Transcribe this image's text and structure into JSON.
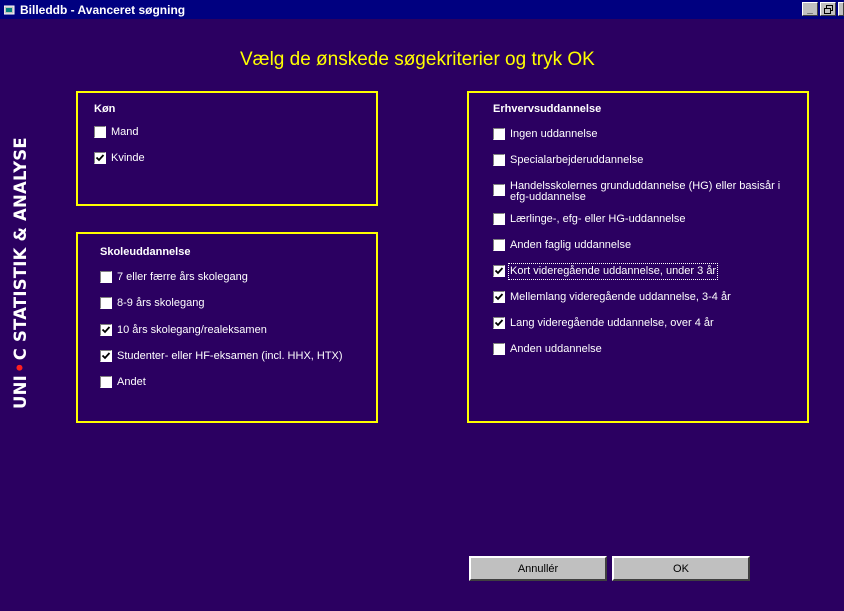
{
  "window": {
    "title": "Billeddb - Avanceret søgning"
  },
  "controls": {
    "minimize": "_",
    "restore": " "
  },
  "brand": {
    "text_left": "UNI",
    "text_right": "C STATISTIK & ANALYSE",
    "dot_color": "#ff2020"
  },
  "heading": "Vælg de ønskede søgekriterier og tryk OK",
  "colors": {
    "background": "#2b0061",
    "border": "#ffff00",
    "titlebar": "#000080"
  },
  "koen": {
    "title": "Køn",
    "items": [
      {
        "label": "Mand",
        "checked": false
      },
      {
        "label": "Kvinde",
        "checked": true
      }
    ]
  },
  "skole": {
    "title": "Skoleuddannelse",
    "items": [
      {
        "label": "7 eller færre års skolegang",
        "checked": false
      },
      {
        "label": "8-9 års skolegang",
        "checked": false
      },
      {
        "label": "10 års skolegang/realeksamen",
        "checked": true
      },
      {
        "label": "Studenter- eller HF-eksamen (incl. HHX, HTX)",
        "checked": true
      },
      {
        "label": "Andet",
        "checked": false
      }
    ]
  },
  "erhverv": {
    "title": "Erhvervsuddannelse",
    "items": [
      {
        "label": "Ingen uddannelse",
        "checked": false
      },
      {
        "label": "Specialarbejderuddannelse",
        "checked": false
      },
      {
        "label": "Handelsskolernes grunduddannelse (HG) eller basisår i efg-uddannelse",
        "checked": false
      },
      {
        "label": "Lærlinge-, efg- eller HG-uddannelse",
        "checked": false
      },
      {
        "label": "Anden faglig uddannelse",
        "checked": false
      },
      {
        "label": "Kort videregående uddannelse, under 3 år",
        "checked": true
      },
      {
        "label": "Mellemlang videregående uddannelse, 3-4 år",
        "checked": true
      },
      {
        "label": "Lang videregående uddannelse, over 4 år",
        "checked": true
      },
      {
        "label": "Anden uddannelse",
        "checked": false
      }
    ]
  },
  "buttons": {
    "cancel": "Annullér",
    "ok": "OK"
  }
}
